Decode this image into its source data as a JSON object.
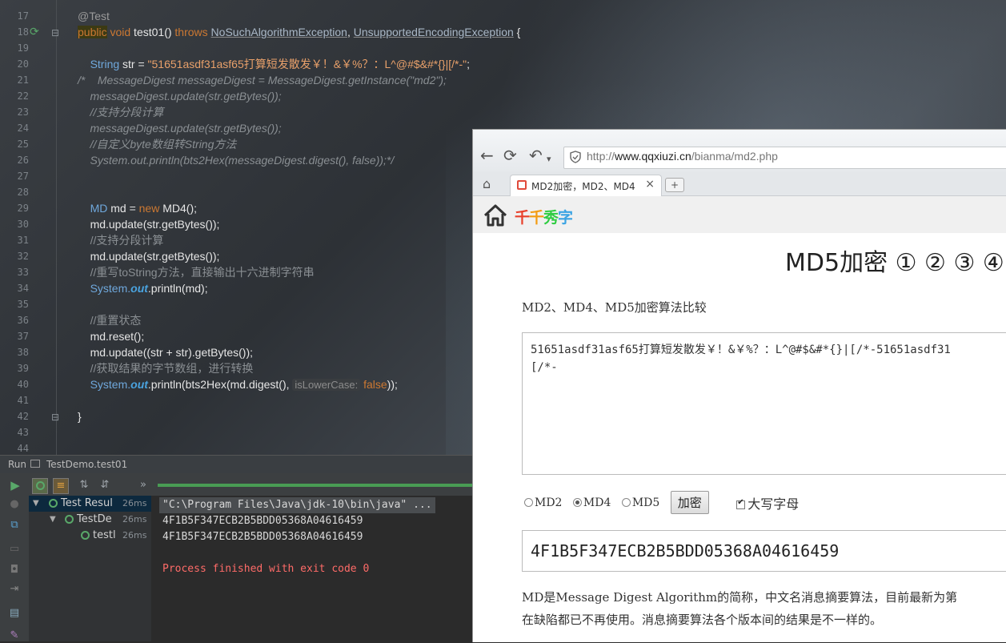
{
  "editor": {
    "line_numbers": [
      "17",
      "18",
      "19",
      "20",
      "21",
      "22",
      "23",
      "24",
      "25",
      "26",
      "27",
      "28",
      "29",
      "30",
      "31",
      "32",
      "33",
      "34",
      "35",
      "36",
      "37",
      "38",
      "39",
      "40",
      "41",
      "42",
      "43",
      "44"
    ],
    "lines": {
      "l17": "@Test",
      "l18_kw": "public",
      "l18_void": "void",
      "l18_name": " test01() ",
      "l18_throws": "throws",
      "l18_ex1": "NoSuchAlgorithmException",
      "l18_comma": ", ",
      "l18_ex2": "UnsupportedEncodingException",
      "l18_brace": " {",
      "l20_type": "String",
      "l20_var": " str = ",
      "l20_str": "\"51651asdf31asf65打算短发散发￥！&￥%？：L^@#$&#*{}|[/*-\"",
      "l20_end": ";",
      "l21": "/*    MessageDigest messageDigest = MessageDigest.getInstance(\"md2\");",
      "l22": "    messageDigest.update(str.getBytes());",
      "l23": "    //支持分段计算",
      "l24": "    messageDigest.update(str.getBytes());",
      "l25": "    //自定义byte数组转String方法",
      "l26": "    System.out.println(bts2Hex(messageDigest.digest(), false));*/",
      "l29_type": "MD",
      "l29_var": " md = ",
      "l29_new": "new",
      "l29_rest": " MD4();",
      "l30": "md.update(str.getBytes());",
      "l31": "//支持分段计算",
      "l32": "md.update(str.getBytes());",
      "l33": "//重写toString方法，直接输出十六进制字符串",
      "l34_sys": "System.",
      "l34_out": "out",
      "l34_rest": ".println(md);",
      "l36": "//重置状态",
      "l37": "md.reset();",
      "l38": "md.update((str + str).getBytes());",
      "l39": "//获取结果的字节数组，进行转换",
      "l40_sys": "System.",
      "l40_out": "out",
      "l40_rest": ".println(bts2Hex(md.digest(), ",
      "l40_hint": "isLowerCase:",
      "l40_false": "false",
      "l40_end": "));",
      "l42": "}"
    }
  },
  "run": {
    "header_label": "Run",
    "config_name": "TestDemo.test01",
    "tree": [
      {
        "label": "Test Resul",
        "time": "26ms"
      },
      {
        "label": "TestDe",
        "time": "26ms"
      },
      {
        "label": "testl",
        "time": "26ms"
      }
    ],
    "output": {
      "cmd": "\"C:\\Program Files\\Java\\jdk-10\\bin\\java\" ...",
      "hash1": "4F1B5F347ECB2B5BDD05368A04616459",
      "hash2": "4F1B5F347ECB2B5BDD05368A04616459",
      "exit": "Process finished with exit code 0"
    },
    "progress": 1.0
  },
  "browser": {
    "url_prefix": "http://",
    "url_domain": "www.qqxiuzi.cn",
    "url_path": "/bianma/md2.php",
    "tab_title": "MD2加密，MD2、MD4",
    "tab_close": "×",
    "tab_new": "+",
    "logo": [
      "千",
      "千",
      "秀",
      "字"
    ],
    "logo_colors": [
      "#e8412c",
      "#f39c12",
      "#2ecc40",
      "#3aa3e3"
    ],
    "page_title": "MD5加密 ① ② ③ ④",
    "subtitle": "MD2、MD4、MD5加密算法比较",
    "input_text": "51651asdf31asf65打算短发散发￥！&￥%？：L^@#$&#*{}|[/*-51651asdf31\n[/*-",
    "options": {
      "md2": "MD2",
      "md4": "MD4",
      "md5": "MD5",
      "selected": "MD4",
      "encrypt_button": "加密",
      "uppercase_label": "大写字母",
      "uppercase_checked": true
    },
    "result": "4F1B5F347ECB2B5BDD05368A04616459",
    "description_line1": "MD是Message Digest Algorithm的简称，中文名消息摘要算法，目前最新为第",
    "description_line2": "在缺陷都已不再使用。消息摘要算法各个版本间的结果是不一样的。"
  }
}
